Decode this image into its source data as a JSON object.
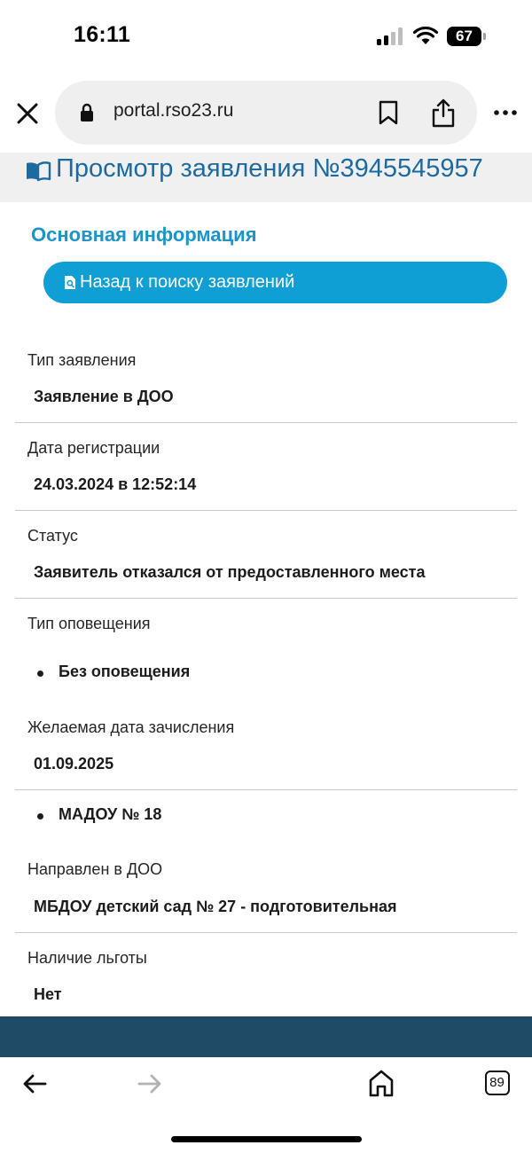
{
  "status_bar": {
    "time": "16:11",
    "battery": "67"
  },
  "browser": {
    "url": "portal.rso23.ru",
    "tab_count": "89"
  },
  "page": {
    "title": "Просмотр заявления №3945545957",
    "section_heading": "Основная информация",
    "back_button_label": "Назад к поиску заявлений"
  },
  "fields": {
    "application_type": {
      "label": "Тип заявления",
      "value": "Заявление в ДОО"
    },
    "registration_date": {
      "label": "Дата регистрации",
      "value": "24.03.2024 в 12:52:14"
    },
    "status": {
      "label": "Статус",
      "value": "Заявитель отказался от предоставленного места"
    },
    "notification_type": {
      "label": "Тип оповещения",
      "items": [
        "Без оповещения"
      ]
    },
    "desired_date": {
      "label": "Желаемая дата зачисления",
      "value": "01.09.2025"
    },
    "preferred_kindergartens": {
      "items": [
        "МАДОУ № 18"
      ]
    },
    "assigned_to": {
      "label": "Направлен в ДОО",
      "value": "МБДОУ детский сад № 27 - подготовительная"
    },
    "benefit": {
      "label": "Наличие льготы",
      "value": "Нет"
    }
  },
  "colors": {
    "accent": "#0f9fd4",
    "title": "#1d6aa0",
    "footer": "#1f4b66"
  }
}
